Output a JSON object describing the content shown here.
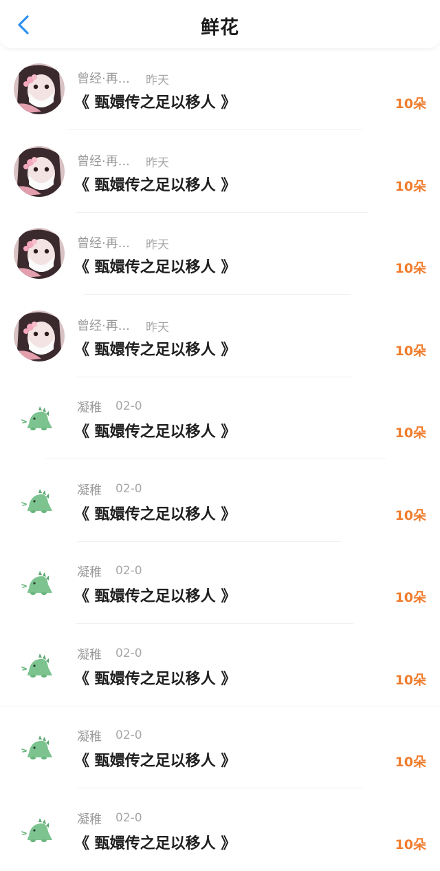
{
  "header": {
    "title": "鲜花",
    "back_icon": "chevron-left-icon",
    "accent_color": "#2e8ff0"
  },
  "list": {
    "count_color": "#f07d2e",
    "items": [
      {
        "avatar": "girl-avatar",
        "name": "曾经·再...",
        "date": "昨天",
        "work": "《 甄嬛传之足以移人 》",
        "count": "10朵"
      },
      {
        "avatar": "girl-avatar",
        "name": "曾经·再...",
        "date": "昨天",
        "work": "《 甄嬛传之足以移人 》",
        "count": "10朵"
      },
      {
        "avatar": "girl-avatar",
        "name": "曾经·再...",
        "date": "昨天",
        "work": "《 甄嬛传之足以移人 》",
        "count": "10朵"
      },
      {
        "avatar": "girl-avatar",
        "name": "曾经·再...",
        "date": "昨天",
        "work": "《 甄嬛传之足以移人 》",
        "count": "10朵"
      },
      {
        "avatar": "dinosaur-avatar",
        "name": "凝稚",
        "date": "02-0",
        "work": "《 甄嬛传之足以移人 》",
        "count": "10朵"
      },
      {
        "avatar": "dinosaur-avatar",
        "name": "凝稚",
        "date": "02-0",
        "work": "《 甄嬛传之足以移人 》",
        "count": "10朵"
      },
      {
        "avatar": "dinosaur-avatar",
        "name": "凝稚",
        "date": "02-0",
        "work": "《 甄嬛传之足以移人 》",
        "count": "10朵"
      },
      {
        "avatar": "dinosaur-avatar",
        "name": "凝稚",
        "date": "02-0",
        "work": "《 甄嬛传之足以移人 》",
        "count": "10朵"
      },
      {
        "avatar": "dinosaur-avatar",
        "name": "凝稚",
        "date": "02-0",
        "work": "《 甄嬛传之足以移人 》",
        "count": "10朵"
      },
      {
        "avatar": "dinosaur-avatar",
        "name": "凝稚",
        "date": "02-0",
        "work": "《 甄嬛传之足以移人 》",
        "count": "10朵"
      }
    ]
  }
}
